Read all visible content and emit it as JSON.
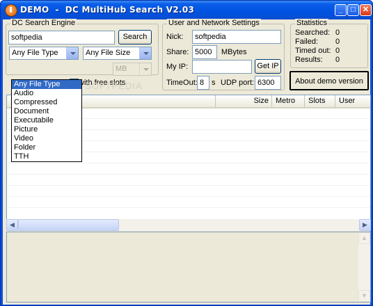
{
  "window": {
    "title": "DEMO  -  DC MultiHub Search V2.03",
    "minimize_glyph": "_",
    "maximize_glyph": "□",
    "close_glyph": "✕"
  },
  "search_engine": {
    "group_label": "DC Search Engine",
    "query_value": "softpedia",
    "search_label": "Search",
    "file_type_selected": "Any File Type",
    "file_size_selected": "Any File Size",
    "size_unit": "MB",
    "free_slots_label": "with free slots",
    "file_type_options": [
      "Any File Type",
      "Audio",
      "Compressed",
      "Document",
      "Executabile",
      "Picture",
      "Video",
      "Folder",
      "TTH"
    ]
  },
  "network": {
    "group_label": "User and Network Settings",
    "nick_label": "Nick:",
    "nick_value": "softpedia",
    "share_label": "Share:",
    "share_value": "5000",
    "share_unit": "MBytes",
    "myip_label": "My IP:",
    "myip_value": "",
    "getip_label": "Get IP",
    "timeout_label": "TimeOut:",
    "timeout_value": "8",
    "timeout_unit": "s",
    "udp_label": "UDP port:",
    "udp_value": "6300"
  },
  "statistics": {
    "group_label": "Statistics",
    "rows": [
      {
        "label": "Searched:",
        "value": "0"
      },
      {
        "label": "Failed:",
        "value": "0"
      },
      {
        "label": "Timed out:",
        "value": "0"
      },
      {
        "label": "Results:",
        "value": "0"
      }
    ]
  },
  "demo_button_label": "About demo version",
  "results": {
    "columns": [
      "Size",
      "Metro",
      "Slots",
      "User"
    ]
  },
  "watermark": "SOFTPEDIA",
  "colors": {
    "title_bar": "#0a5ee8",
    "selection": "#316ac5",
    "window_bg": "#ece9d8"
  }
}
